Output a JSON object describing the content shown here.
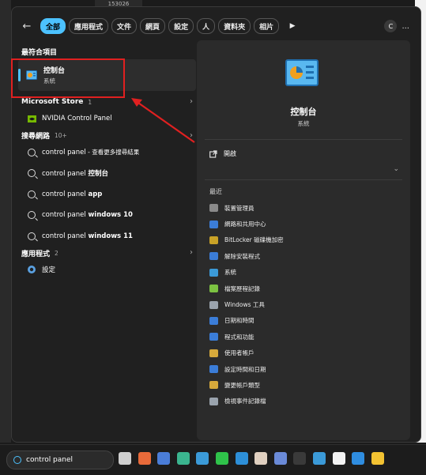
{
  "desktop": {
    "top_text": "153026"
  },
  "filters": {
    "back_icon": "back-arrow-icon",
    "chips": [
      "全部",
      "應用程式",
      "文件",
      "網頁",
      "設定",
      "人",
      "資料夾",
      "相片"
    ],
    "active_index": 0,
    "avatar_letter": "C",
    "more": "..."
  },
  "left": {
    "best_match": {
      "section": "最符合項目",
      "title": "控制台",
      "subtitle": "系統"
    },
    "store": {
      "section": "Microsoft Store",
      "count": "1",
      "item": "NVIDIA Control Panel"
    },
    "web": {
      "section": "搜尋網路",
      "count": "10+",
      "items": [
        {
          "pre": "control panel",
          "bold": "",
          "post": " - 查看更多搜尋結果"
        },
        {
          "pre": "control panel ",
          "bold": "控制台",
          "post": ""
        },
        {
          "pre": "control panel ",
          "bold": "app",
          "post": ""
        },
        {
          "pre": "control panel ",
          "bold": "windows 10",
          "post": ""
        },
        {
          "pre": "control panel ",
          "bold": "windows 11",
          "post": ""
        }
      ]
    },
    "apps": {
      "section": "應用程式",
      "count": "2",
      "item": "設定"
    }
  },
  "preview": {
    "title": "控制台",
    "subtitle": "系統",
    "open_label": "開啟",
    "recent_title": "最近",
    "recent": [
      {
        "label": "裝置管理員",
        "color": "#8a8a8a"
      },
      {
        "label": "網路和共用中心",
        "color": "#3b7dd8"
      },
      {
        "label": "BitLocker 磁碟機加密",
        "color": "#c9a227"
      },
      {
        "label": "解除安裝程式",
        "color": "#3b7dd8"
      },
      {
        "label": "系統",
        "color": "#3b9ad8"
      },
      {
        "label": "檔案歷程記錄",
        "color": "#7cc242"
      },
      {
        "label": "Windows 工具",
        "color": "#9aa3ad"
      },
      {
        "label": "日期和時間",
        "color": "#3b7dd8"
      },
      {
        "label": "程式和功能",
        "color": "#3b7dd8"
      },
      {
        "label": "使用者帳戶",
        "color": "#d6a93b"
      },
      {
        "label": "設定時間和日期",
        "color": "#3b7dd8"
      },
      {
        "label": "變更帳戶類型",
        "color": "#d6a93b"
      },
      {
        "label": "檢視事件記錄檔",
        "color": "#9aa3ad"
      }
    ]
  },
  "taskbar": {
    "search_value": "control panel",
    "icons": [
      {
        "name": "task-view-icon",
        "color": "#cfcfcf"
      },
      {
        "name": "copilot-icon",
        "color": "#e86a3a"
      },
      {
        "name": "calculator-icon",
        "color": "#4a7dd8"
      },
      {
        "name": "edge-dev-icon",
        "color": "#3bb58f"
      },
      {
        "name": "remote-desktop-icon",
        "color": "#3b9ad8"
      },
      {
        "name": "line-icon",
        "color": "#2fc24a"
      },
      {
        "name": "edge-icon",
        "color": "#2d8fd8"
      },
      {
        "name": "paint-icon",
        "color": "#e0d0c0"
      },
      {
        "name": "network-icon",
        "color": "#6a8ad8"
      },
      {
        "name": "terminal-icon",
        "color": "#3a3a3a"
      },
      {
        "name": "photos-icon",
        "color": "#3b9ad8"
      },
      {
        "name": "store-icon",
        "color": "#f2f2f2"
      },
      {
        "name": "vscode-icon",
        "color": "#2f8de0"
      },
      {
        "name": "file-explorer-icon",
        "color": "#f2c232"
      }
    ]
  }
}
